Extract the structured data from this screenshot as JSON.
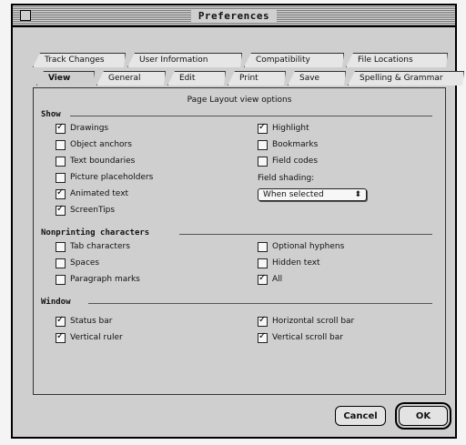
{
  "window": {
    "title": "Preferences"
  },
  "tabs": {
    "back_row": [
      "Track Changes",
      "User Information",
      "Compatibility",
      "File Locations"
    ],
    "front_row": [
      "View",
      "General",
      "Edit",
      "Print",
      "Save",
      "Spelling & Grammar"
    ],
    "active": "View"
  },
  "panel": {
    "caption": "Page Layout view options",
    "show": {
      "title": "Show",
      "left": [
        {
          "label": "Drawings",
          "checked": true
        },
        {
          "label": "Object anchors",
          "checked": false
        },
        {
          "label": "Text boundaries",
          "checked": false
        },
        {
          "label": "Picture placeholders",
          "checked": false
        },
        {
          "label": "Animated text",
          "checked": true
        },
        {
          "label": "ScreenTips",
          "checked": true
        }
      ],
      "right": [
        {
          "label": "Highlight",
          "checked": true
        },
        {
          "label": "Bookmarks",
          "checked": false
        },
        {
          "label": "Field codes",
          "checked": false
        }
      ],
      "field_shading_label": "Field shading:",
      "field_shading_value": "When selected"
    },
    "nonprinting": {
      "title": "Nonprinting characters",
      "left": [
        {
          "label": "Tab characters",
          "checked": false
        },
        {
          "label": "Spaces",
          "checked": false
        },
        {
          "label": "Paragraph marks",
          "checked": false
        }
      ],
      "right": [
        {
          "label": "Optional hyphens",
          "checked": false
        },
        {
          "label": "Hidden text",
          "checked": false
        },
        {
          "label": "All",
          "checked": true
        }
      ]
    },
    "window": {
      "title": "Window",
      "left": [
        {
          "label": "Status bar",
          "checked": true
        },
        {
          "label": "Vertical ruler",
          "checked": true
        }
      ],
      "right": [
        {
          "label": "Horizontal scroll bar",
          "checked": true
        },
        {
          "label": "Vertical scroll bar",
          "checked": true
        }
      ]
    }
  },
  "buttons": {
    "cancel": "Cancel",
    "ok": "OK"
  }
}
